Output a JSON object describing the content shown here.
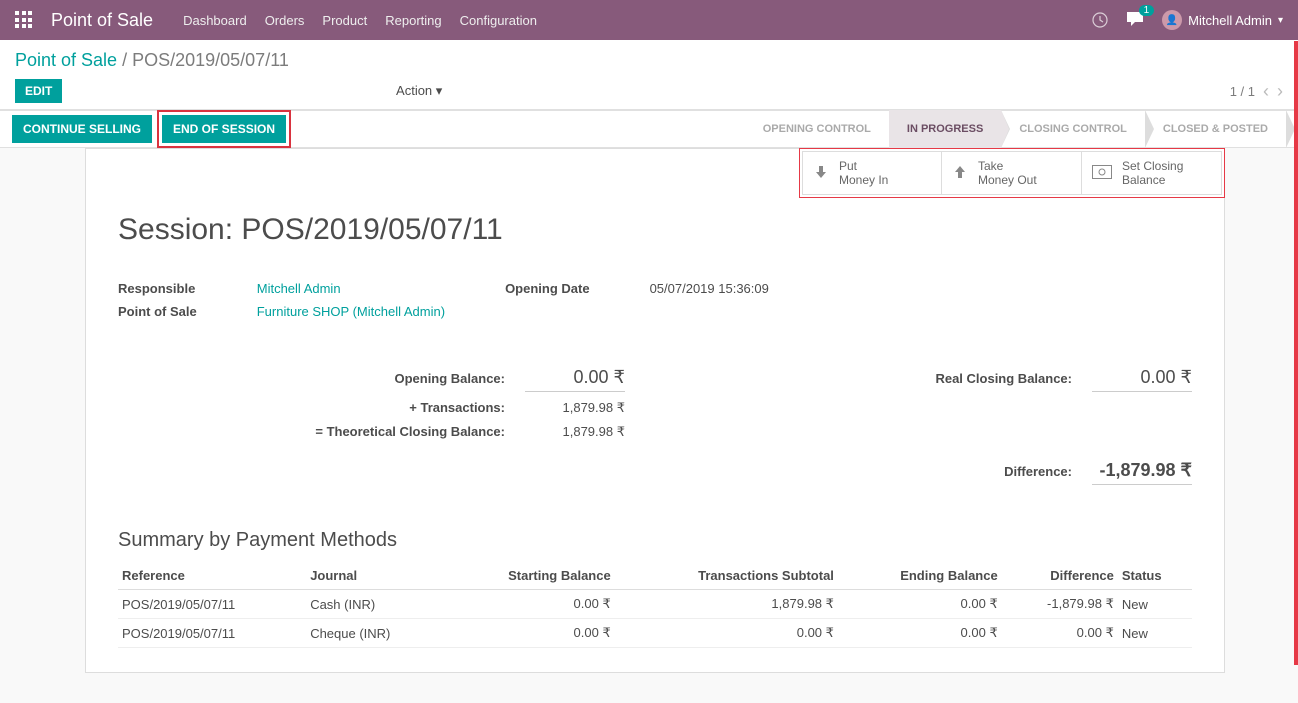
{
  "topbar": {
    "brand": "Point of Sale",
    "nav": [
      "Dashboard",
      "Orders",
      "Product",
      "Reporting",
      "Configuration"
    ],
    "badge_count": "1",
    "user_name": "Mitchell Admin"
  },
  "breadcrumb": {
    "root": "Point of Sale",
    "sep": " / ",
    "current": "POS/2019/05/07/11"
  },
  "buttons": {
    "edit": "EDIT",
    "action": "Action",
    "continue_selling": "CONTINUE SELLING",
    "end_session": "END OF SESSION"
  },
  "pager": {
    "text": "1 / 1"
  },
  "stages": [
    "OPENING CONTROL",
    "IN PROGRESS",
    "CLOSING CONTROL",
    "CLOSED & POSTED"
  ],
  "active_stage_index": 1,
  "stat_buttons": {
    "put_money_in": "Put\nMoney In",
    "take_money_out": "Take\nMoney Out",
    "set_closing_balance": "Set Closing\nBalance"
  },
  "title": "Session: POS/2019/05/07/11",
  "info": {
    "responsible_label": "Responsible",
    "responsible_value": "Mitchell Admin",
    "pos_label": "Point of Sale",
    "pos_value": "Furniture SHOP (Mitchell Admin)",
    "opening_date_label": "Opening Date",
    "opening_date_value": "05/07/2019 15:36:09"
  },
  "balances": {
    "opening_label": "Opening Balance:",
    "opening_value": "0.00 ₹",
    "transactions_label": "+ Transactions:",
    "transactions_value": "1,879.98 ₹",
    "theoretical_label": "= Theoretical Closing Balance:",
    "theoretical_value": "1,879.98 ₹",
    "real_closing_label": "Real Closing Balance:",
    "real_closing_value": "0.00 ₹",
    "difference_label": "Difference:",
    "difference_value": "-1,879.98 ₹"
  },
  "summary": {
    "title": "Summary by Payment Methods",
    "headers": {
      "reference": "Reference",
      "journal": "Journal",
      "starting_balance": "Starting Balance",
      "transactions_subtotal": "Transactions Subtotal",
      "ending_balance": "Ending Balance",
      "difference": "Difference",
      "status": "Status"
    },
    "rows": [
      {
        "reference": "POS/2019/05/07/11",
        "journal": "Cash (INR)",
        "starting": "0.00 ₹",
        "subtotal": "1,879.98 ₹",
        "ending": "0.00 ₹",
        "difference": "-1,879.98 ₹",
        "status": "New"
      },
      {
        "reference": "POS/2019/05/07/11",
        "journal": "Cheque (INR)",
        "starting": "0.00 ₹",
        "subtotal": "0.00 ₹",
        "ending": "0.00 ₹",
        "difference": "0.00 ₹",
        "status": "New"
      }
    ]
  }
}
